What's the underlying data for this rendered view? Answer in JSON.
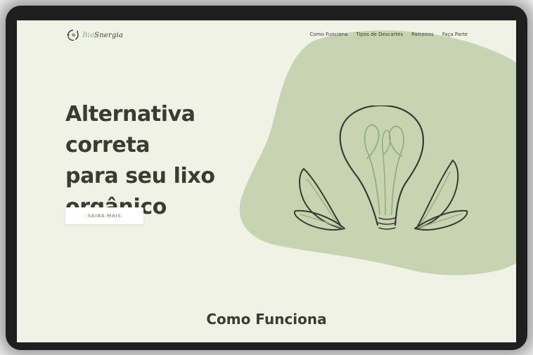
{
  "brand": {
    "name_prefix": "Bio",
    "name_suffix": "Snergia",
    "logo_icon": "recycle-leaf-icon"
  },
  "nav": {
    "items": [
      {
        "label": "Como Funciona"
      },
      {
        "label": "Tipos de Descartes"
      },
      {
        "label": "Parceiros"
      },
      {
        "label": "Faça Parte"
      }
    ]
  },
  "hero": {
    "title_line1": "Alternativa correta",
    "title_line2": "para seu lixo",
    "title_line3": "orgânico",
    "cta_label": "SAIBA MAIS",
    "illustration": "lightbulb-with-leaves-icon"
  },
  "section": {
    "title": "Como Funciona"
  },
  "colors": {
    "background": "#f1f2e6",
    "blob": "#c8d3b1",
    "accent": "#8fb07e",
    "text": "#3b3b33"
  }
}
